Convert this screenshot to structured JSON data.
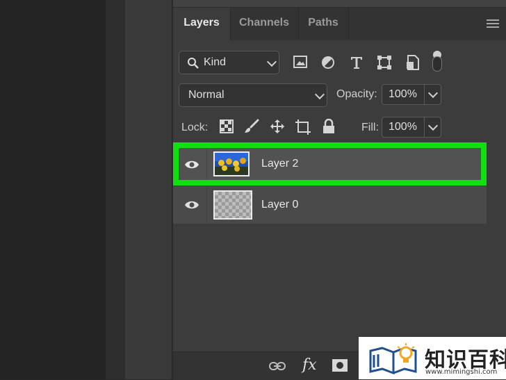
{
  "tabs": [
    {
      "label": "Layers",
      "active": true
    },
    {
      "label": "Channels",
      "active": false
    },
    {
      "label": "Paths",
      "active": false
    }
  ],
  "filter": {
    "kind_label": "Kind"
  },
  "blend": {
    "mode": "Normal",
    "opacity_label": "Opacity:",
    "opacity_value": "100%"
  },
  "lock": {
    "label": "Lock:",
    "fill_label": "Fill:",
    "fill_value": "100%"
  },
  "layers": [
    {
      "name": "Layer 2",
      "selected": true,
      "highlight_color": "#10e010"
    },
    {
      "name": "Layer 0",
      "selected": false
    }
  ],
  "icons": [
    "search-icon",
    "image-filter-icon",
    "adjustment-filter-icon",
    "type-filter-icon",
    "shape-filter-icon",
    "smart-object-filter-icon",
    "filter-toggle-icon",
    "chevron-down-icon",
    "lock-transparent-icon",
    "lock-brush-icon",
    "lock-position-icon",
    "lock-artboard-icon",
    "lock-all-icon",
    "eye-icon",
    "link-icon",
    "fx-icon",
    "mask-icon",
    "panel-menu-icon"
  ],
  "bottom": {
    "fx_label": "fx"
  },
  "watermark": {
    "cn": "知识百科",
    "url": "www.mimingshi.com"
  }
}
